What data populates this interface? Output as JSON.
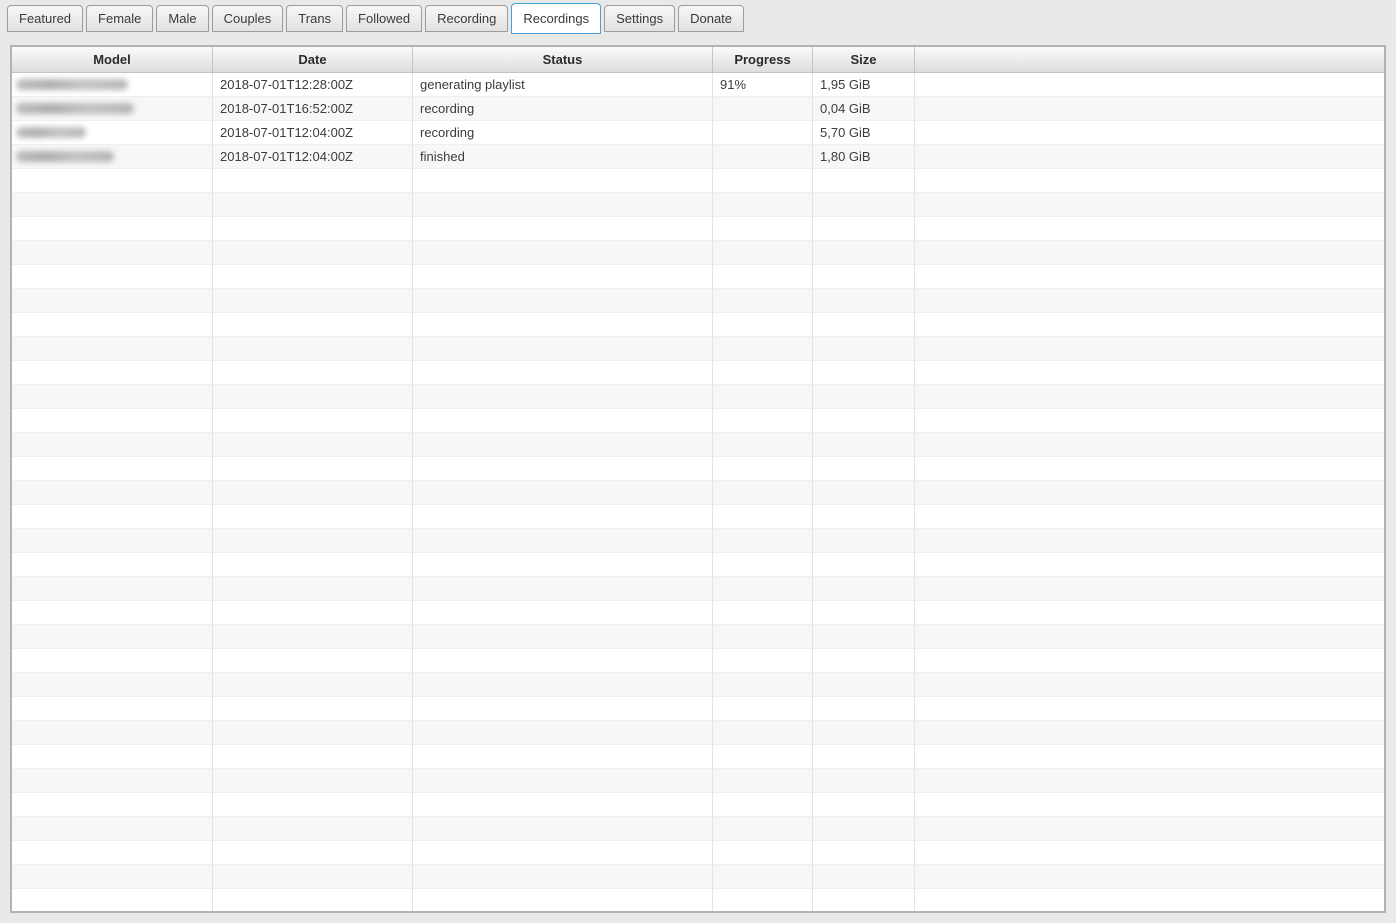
{
  "tabs": {
    "items": [
      {
        "label": "Featured",
        "active": false
      },
      {
        "label": "Female",
        "active": false
      },
      {
        "label": "Male",
        "active": false
      },
      {
        "label": "Couples",
        "active": false
      },
      {
        "label": "Trans",
        "active": false
      },
      {
        "label": "Followed",
        "active": false
      },
      {
        "label": "Recording",
        "active": false
      },
      {
        "label": "Recordings",
        "active": true
      },
      {
        "label": "Settings",
        "active": false
      },
      {
        "label": "Donate",
        "active": false
      }
    ]
  },
  "table": {
    "columns": [
      "Model",
      "Date",
      "Status",
      "Progress",
      "Size",
      ""
    ],
    "rows": [
      {
        "model_redacted": true,
        "redaction_width": 112,
        "date": "2018-07-01T12:28:00Z",
        "status": "generating playlist",
        "progress": "91%",
        "size": "1,95 GiB"
      },
      {
        "model_redacted": true,
        "redaction_width": 118,
        "date": "2018-07-01T16:52:00Z",
        "status": "recording",
        "progress": "",
        "size": "0,04 GiB"
      },
      {
        "model_redacted": true,
        "redaction_width": 70,
        "date": "2018-07-01T12:04:00Z",
        "status": "recording",
        "progress": "",
        "size": "5,70 GiB"
      },
      {
        "model_redacted": true,
        "redaction_width": 98,
        "date": "2018-07-01T12:04:00Z",
        "status": "finished",
        "progress": "",
        "size": "1,80 GiB"
      }
    ],
    "empty_row_count": 31
  },
  "colors": {
    "active_tab_border": "#49a0d5",
    "row_stripe": "#f7f7f7"
  }
}
